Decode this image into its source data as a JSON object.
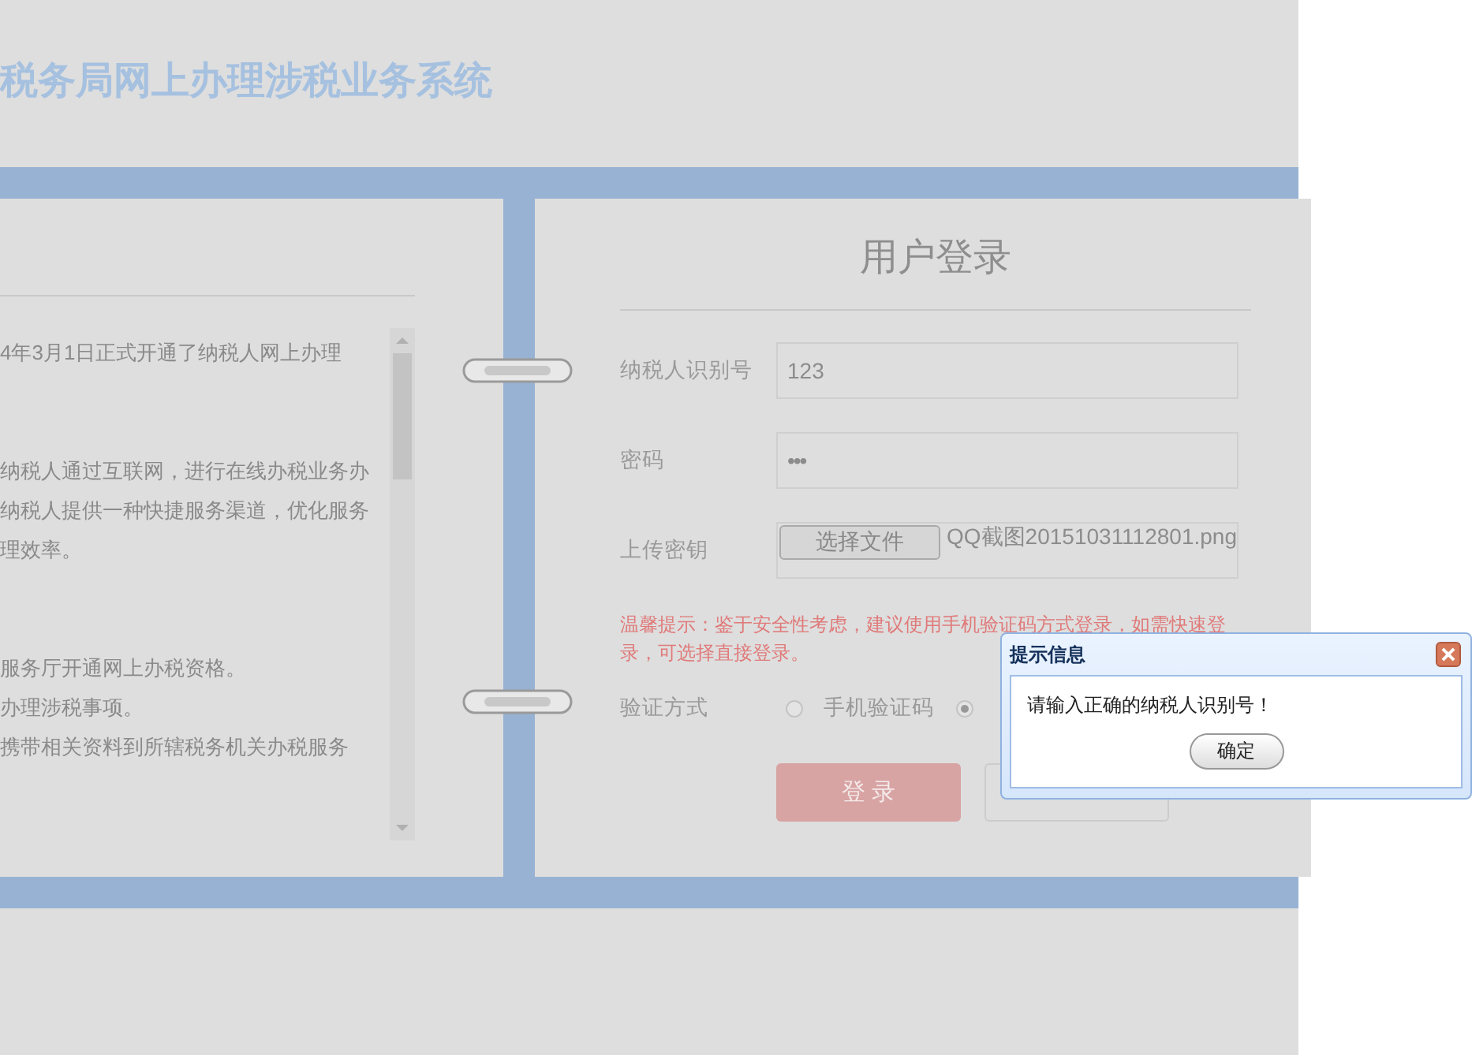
{
  "header": {
    "title": "税务局网上办理涉税业务系统"
  },
  "notice": {
    "paragraphs": [
      [
        "4年3月1日正式开通了纳税人网上办理"
      ],
      [
        "纳税人通过互联网，进行在线办税业务办",
        "纳税人提供一种快捷服务渠道，优化服务",
        "理效率。"
      ],
      [
        "服务厅开通网上办税资格。",
        "办理涉税事项。",
        "携带相关资料到所辖税务机关办税服务"
      ]
    ]
  },
  "login": {
    "title": "用户登录",
    "fields": [
      {
        "kind": "text",
        "label": "纳税人识别号",
        "value": "123"
      },
      {
        "kind": "password",
        "label": "密码",
        "value": "•••"
      },
      {
        "kind": "file",
        "label": "上传密钥",
        "button": "选择文件",
        "value": "QQ截图20151031112801.png"
      }
    ],
    "hint": [
      "温馨提示：鉴于安全性考虑，建议使用手机验证码方式登录，如需快速登",
      "录，可选择直接登录。"
    ],
    "verify": {
      "label": "验证方式",
      "options": [
        {
          "label": "手机验证码",
          "selected": false
        },
        {
          "selected": true
        }
      ]
    },
    "buttons": [
      {
        "kind": "primary",
        "label": "登 录"
      },
      {
        "kind": "secondary"
      }
    ]
  },
  "dialog": {
    "title": "提示信息",
    "message": "请输入正确的纳税人识别号！",
    "button": "确定"
  }
}
